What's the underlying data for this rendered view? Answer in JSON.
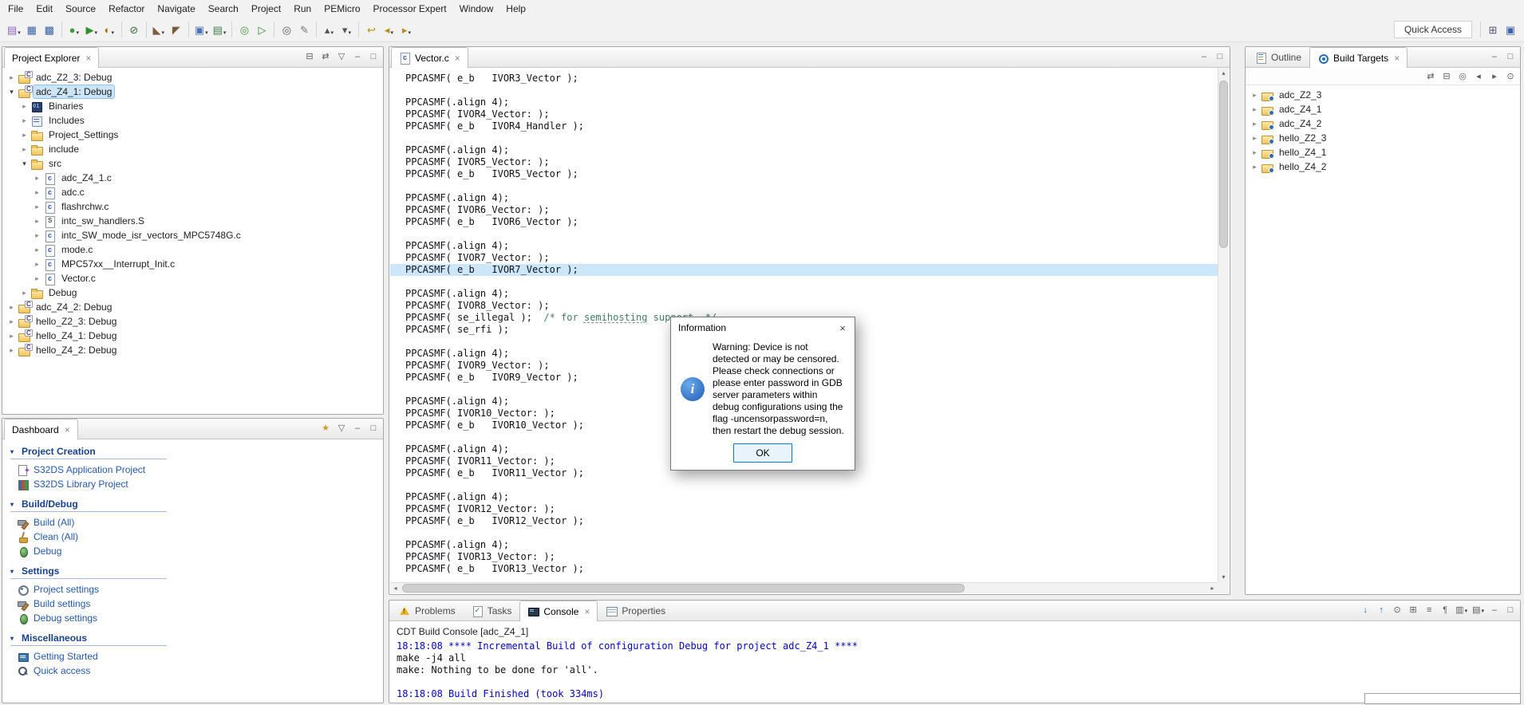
{
  "glyphs": {
    "collapsed": "▸",
    "expanded": "▾",
    "dropdown": "▾",
    "close": "×",
    "minimize": "–",
    "maximize": "□",
    "up": "▴",
    "down": "▾",
    "left": "◂",
    "right": "▸"
  },
  "menubar": {
    "items": [
      "File",
      "Edit",
      "Source",
      "Refactor",
      "Navigate",
      "Search",
      "Project",
      "Run",
      "PEMicro",
      "Processor Expert",
      "Window",
      "Help"
    ]
  },
  "toolbar": {
    "quick_access": "Quick Access",
    "buttons": [
      {
        "name": "new",
        "glyph": "▤",
        "color": "#8a63c2",
        "dd": true
      },
      {
        "name": "save",
        "glyph": "▦",
        "color": "#3a62a8"
      },
      {
        "name": "save-all",
        "glyph": "▩",
        "color": "#3a62a8"
      },
      {
        "sep": true
      },
      {
        "name": "debug",
        "glyph": "●",
        "color": "#3f9b3f",
        "dd": true
      },
      {
        "name": "run",
        "glyph": "▶",
        "color": "#2f8f2f",
        "dd": true
      },
      {
        "name": "profile",
        "glyph": "◐",
        "color": "#b06a00",
        "dd": true
      },
      {
        "sep": true
      },
      {
        "name": "skip-all-breakpoints",
        "glyph": "⊘",
        "color": "#356c35"
      },
      {
        "sep": true
      },
      {
        "name": "build",
        "glyph": "◣",
        "color": "#7a5c3a",
        "dd": true
      },
      {
        "name": "build-all",
        "glyph": "◤",
        "color": "#7a5c3a"
      },
      {
        "sep": true
      },
      {
        "name": "new-c-cpp-project",
        "glyph": "▣",
        "color": "#4a6fb5",
        "dd": true
      },
      {
        "name": "new-source-file",
        "glyph": "▤",
        "color": "#3f7a4a",
        "dd": true
      },
      {
        "sep": true
      },
      {
        "name": "debug-configurations",
        "glyph": "◎",
        "color": "#3f9b3f"
      },
      {
        "name": "run-configurations",
        "glyph": "▷",
        "color": "#2f8f2f"
      },
      {
        "sep": true
      },
      {
        "name": "search",
        "glyph": "◎",
        "color": "#555555"
      },
      {
        "name": "toggle-mark-occurrences",
        "glyph": "✎",
        "color": "#777777"
      },
      {
        "sep": true
      },
      {
        "name": "previous-annotation",
        "glyph": "▴",
        "color": "#555555",
        "dd": true
      },
      {
        "name": "next-annotation",
        "glyph": "▾",
        "color": "#555555",
        "dd": true
      },
      {
        "sep": true
      },
      {
        "name": "last-edit-location",
        "glyph": "↩",
        "color": "#b09020"
      },
      {
        "name": "back",
        "glyph": "◂",
        "color": "#b09020",
        "dd": true
      },
      {
        "name": "forward",
        "glyph": "▸",
        "color": "#b09020",
        "dd": true
      }
    ],
    "right_icons": [
      {
        "name": "open-perspective",
        "glyph": "⊞",
        "color": "#555577"
      },
      {
        "name": "cpp-perspective",
        "glyph": "▣",
        "color": "#3a62a8"
      }
    ]
  },
  "project_explorer": {
    "tab": {
      "label": "Project Explorer",
      "active": true
    },
    "header_icons": [
      {
        "name": "collapse-all",
        "glyph": "⊟"
      },
      {
        "name": "link-with-editor",
        "glyph": "⇄"
      },
      {
        "name": "view-menu",
        "glyph": "▽"
      },
      {
        "name": "minimize",
        "glyph": "–"
      },
      {
        "name": "maximize",
        "glyph": "□"
      }
    ],
    "tree": [
      {
        "label": "adc_Z2_3: Debug",
        "level": 0,
        "icon": "project",
        "expanded": false
      },
      {
        "label": "adc_Z4_1: Debug",
        "level": 0,
        "icon": "project",
        "expanded": true,
        "selected": true
      },
      {
        "label": "Binaries",
        "level": 1,
        "icon": "binaries",
        "expanded": false
      },
      {
        "label": "Includes",
        "level": 1,
        "icon": "includes",
        "expanded": false
      },
      {
        "label": "Project_Settings",
        "level": 1,
        "icon": "folder",
        "expanded": false
      },
      {
        "label": "include",
        "level": 1,
        "icon": "folder",
        "expanded": false
      },
      {
        "label": "src",
        "level": 1,
        "icon": "folder",
        "expanded": true
      },
      {
        "label": "adc_Z4_1.c",
        "level": 2,
        "icon": "cfile",
        "expanded": false
      },
      {
        "label": "adc.c",
        "level": 2,
        "icon": "cfile",
        "expanded": false
      },
      {
        "label": "flashrchw.c",
        "level": 2,
        "icon": "cfile",
        "expanded": false
      },
      {
        "label": "intc_sw_handlers.S",
        "level": 2,
        "icon": "sfile",
        "expanded": false
      },
      {
        "label": "intc_SW_mode_isr_vectors_MPC5748G.c",
        "level": 2,
        "icon": "cfile",
        "expanded": false
      },
      {
        "label": "mode.c",
        "level": 2,
        "icon": "cfile",
        "expanded": false
      },
      {
        "label": "MPC57xx__Interrupt_Init.c",
        "level": 2,
        "icon": "cfile",
        "expanded": false
      },
      {
        "label": "Vector.c",
        "level": 2,
        "icon": "cfile",
        "expanded": false
      },
      {
        "label": "Debug",
        "level": 1,
        "icon": "folder",
        "expanded": false
      },
      {
        "label": "adc_Z4_2: Debug",
        "level": 0,
        "icon": "project",
        "expanded": false
      },
      {
        "label": "hello_Z2_3: Debug",
        "level": 0,
        "icon": "project",
        "expanded": false
      },
      {
        "label": "hello_Z4_1: Debug",
        "level": 0,
        "icon": "project",
        "expanded": false
      },
      {
        "label": "hello_Z4_2: Debug",
        "level": 0,
        "icon": "project",
        "expanded": false
      }
    ]
  },
  "dashboard": {
    "tab": {
      "label": "Dashboard",
      "active": true
    },
    "header_icons": [
      {
        "name": "customize",
        "glyph": "★",
        "color": "#c9a227"
      },
      {
        "name": "view-menu",
        "glyph": "▽"
      },
      {
        "name": "minimize",
        "glyph": "–"
      },
      {
        "name": "maximize",
        "glyph": "□"
      }
    ],
    "sections": [
      {
        "label": "Project Creation",
        "items": [
          {
            "label": "S32DS Application Project",
            "icon": "app-project"
          },
          {
            "label": "S32DS Library Project",
            "icon": "lib-project"
          }
        ]
      },
      {
        "label": "Build/Debug",
        "items": [
          {
            "label": "Build   (All)",
            "icon": "build"
          },
          {
            "label": "Clean  (All)",
            "icon": "clean"
          },
          {
            "label": "Debug",
            "icon": "debug"
          }
        ]
      },
      {
        "label": "Settings",
        "items": [
          {
            "label": "Project settings",
            "icon": "project-settings"
          },
          {
            "label": "Build settings",
            "icon": "build-settings"
          },
          {
            "label": "Debug settings",
            "icon": "debug-settings"
          }
        ]
      },
      {
        "label": "Miscellaneous",
        "items": [
          {
            "label": "Getting Started",
            "icon": "getting-started"
          },
          {
            "label": "Quick access",
            "icon": "quick-access"
          }
        ]
      }
    ]
  },
  "editor": {
    "tab": {
      "label": "Vector.c",
      "icon": "cfile",
      "active": true
    },
    "header_icons": [
      {
        "name": "minimize",
        "glyph": "–"
      },
      {
        "name": "maximize",
        "glyph": "□"
      }
    ],
    "highlight_line": 16,
    "misspelled_word": "semihosting",
    "lines": [
      "PPCASMF( e_b   IVOR3_Vector );",
      "",
      "PPCASMF(.align 4);",
      "PPCASMF( IVOR4_Vector: );",
      "PPCASMF( e_b   IVOR4_Handler );",
      "",
      "PPCASMF(.align 4);",
      "PPCASMF( IVOR5_Vector: );",
      "PPCASMF( e_b   IVOR5_Vector );",
      "",
      "PPCASMF(.align 4);",
      "PPCASMF( IVOR6_Vector: );",
      "PPCASMF( e_b   IVOR6_Vector );",
      "",
      "PPCASMF(.align 4);",
      "PPCASMF( IVOR7_Vector: );",
      "PPCASMF( e_b   IVOR7_Vector );",
      "",
      "PPCASMF(.align 4);",
      "PPCASMF( IVOR8_Vector: );",
      "PPCASMF( se_illegal );  /* for semihosting support  */",
      "PPCASMF( se_rfi );",
      "",
      "PPCASMF(.align 4);",
      "PPCASMF( IVOR9_Vector: );",
      "PPCASMF( e_b   IVOR9_Vector );",
      "",
      "PPCASMF(.align 4);",
      "PPCASMF( IVOR10_Vector: );",
      "PPCASMF( e_b   IVOR10_Vector );",
      "",
      "PPCASMF(.align 4);",
      "PPCASMF( IVOR11_Vector: );",
      "PPCASMF( e_b   IVOR11_Vector );",
      "",
      "PPCASMF(.align 4);",
      "PPCASMF( IVOR12_Vector: );",
      "PPCASMF( e_b   IVOR12_Vector );",
      "",
      "PPCASMF(.align 4);",
      "PPCASMF( IVOR13_Vector: );",
      "PPCASMF( e_b   IVOR13_Vector );"
    ]
  },
  "console": {
    "tabs": [
      {
        "label": "Problems",
        "icon": "problems"
      },
      {
        "label": "Tasks",
        "icon": "tasks"
      },
      {
        "label": "Console",
        "icon": "console",
        "active": true
      },
      {
        "label": "Properties",
        "icon": "properties"
      }
    ],
    "toolbar_icons": [
      {
        "name": "show-console-on-output",
        "glyph": "↓",
        "color": "#2563c4"
      },
      {
        "name": "show-console-on-error",
        "glyph": "↑",
        "color": "#2563c4"
      },
      {
        "name": "pin-console",
        "glyph": "⊙"
      },
      {
        "name": "clear-console",
        "glyph": "⊞"
      },
      {
        "name": "scroll-lock",
        "glyph": "≡"
      },
      {
        "name": "word-wrap",
        "glyph": "¶"
      },
      {
        "name": "display-selected-console",
        "glyph": "▥",
        "dd": true
      },
      {
        "name": "open-console",
        "glyph": "▤",
        "dd": true
      },
      {
        "name": "minimize",
        "glyph": "–"
      },
      {
        "name": "maximize",
        "glyph": "□"
      }
    ],
    "title": "CDT Build Console [adc_Z4_1]",
    "lines": [
      {
        "text": "18:18:08 **** Incremental Build of configuration Debug for project adc_Z4_1 ****",
        "style": "info"
      },
      {
        "text": "make -j4 all",
        "style": "out"
      },
      {
        "text": "make: Nothing to be done for 'all'.",
        "style": "out"
      },
      {
        "text": "",
        "style": "out"
      },
      {
        "text": "18:18:08 Build Finished (took 334ms)",
        "style": "info"
      }
    ]
  },
  "right_panel": {
    "tabs": [
      {
        "label": "Outline",
        "icon": "outline"
      },
      {
        "label": "Build Targets",
        "icon": "build-targets",
        "active": true
      }
    ],
    "header_icons": [
      {
        "name": "minimize",
        "glyph": "–"
      },
      {
        "name": "maximize",
        "glyph": "□"
      }
    ],
    "toolbar_icons": [
      {
        "name": "sort",
        "glyph": "⇄"
      },
      {
        "name": "collapse-all",
        "glyph": "⊟"
      },
      {
        "name": "focus",
        "glyph": "◎"
      },
      {
        "name": "back",
        "glyph": "◂"
      },
      {
        "name": "forward",
        "glyph": "▸"
      },
      {
        "name": "pin",
        "glyph": "⊙"
      }
    ],
    "targets": [
      "adc_Z2_3",
      "adc_Z4_1",
      "adc_Z4_2",
      "hello_Z2_3",
      "hello_Z4_1",
      "hello_Z4_2"
    ]
  },
  "dialog": {
    "title": "Information",
    "message": "Warning: Device is not detected or may be censored. Please check connections or please enter password in GDB server parameters within debug configurations using the flag -uncensorpassword=n, then restart the debug session.",
    "ok_label": "OK"
  }
}
